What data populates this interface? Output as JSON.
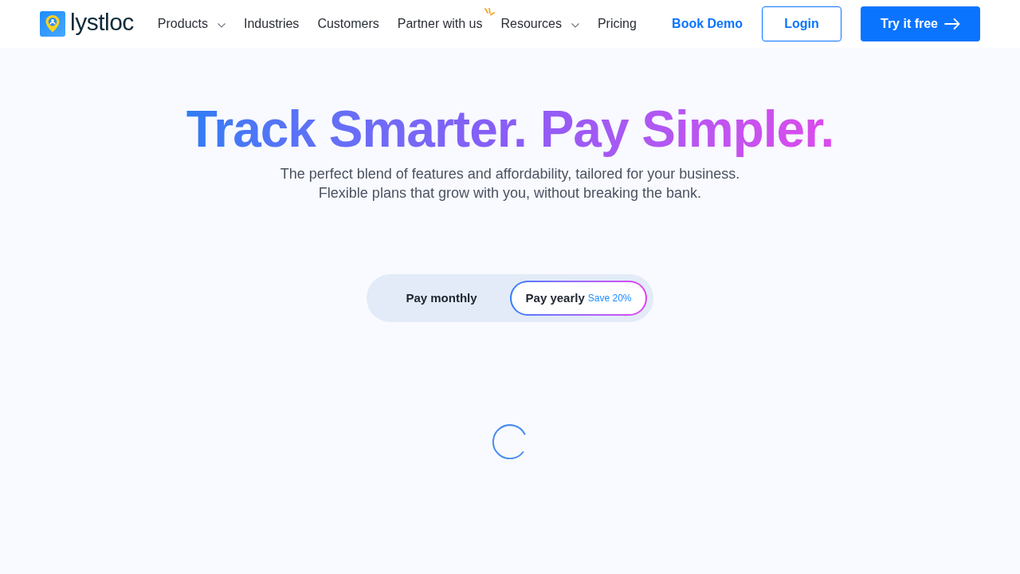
{
  "header": {
    "logo": {
      "text": "lystloc"
    },
    "nav": [
      {
        "label": "Products",
        "kind": "dropdown"
      },
      {
        "label": "Industries",
        "kind": "link"
      },
      {
        "label": "Customers",
        "kind": "link"
      },
      {
        "label": "Partner with us",
        "kind": "highlight"
      },
      {
        "label": "Resources",
        "kind": "dropdown"
      },
      {
        "label": "Pricing",
        "kind": "link"
      }
    ],
    "actions": [
      {
        "label": "Book Demo",
        "kind": "text"
      },
      {
        "label": "Login",
        "kind": "outline"
      },
      {
        "label": "Try it free",
        "kind": "primary"
      }
    ]
  },
  "hero": {
    "title": "Track Smarter. Pay Simpler.",
    "subtitle_lines": [
      "The perfect blend of features and affordability, tailored for your business.",
      "Flexible plans that grow with you, without breaking the bank."
    ]
  },
  "billing_toggle": [
    {
      "label": "Pay monthly",
      "selected": false
    },
    {
      "label": "Pay yearly",
      "note": "Save 20%",
      "selected": true
    }
  ]
}
